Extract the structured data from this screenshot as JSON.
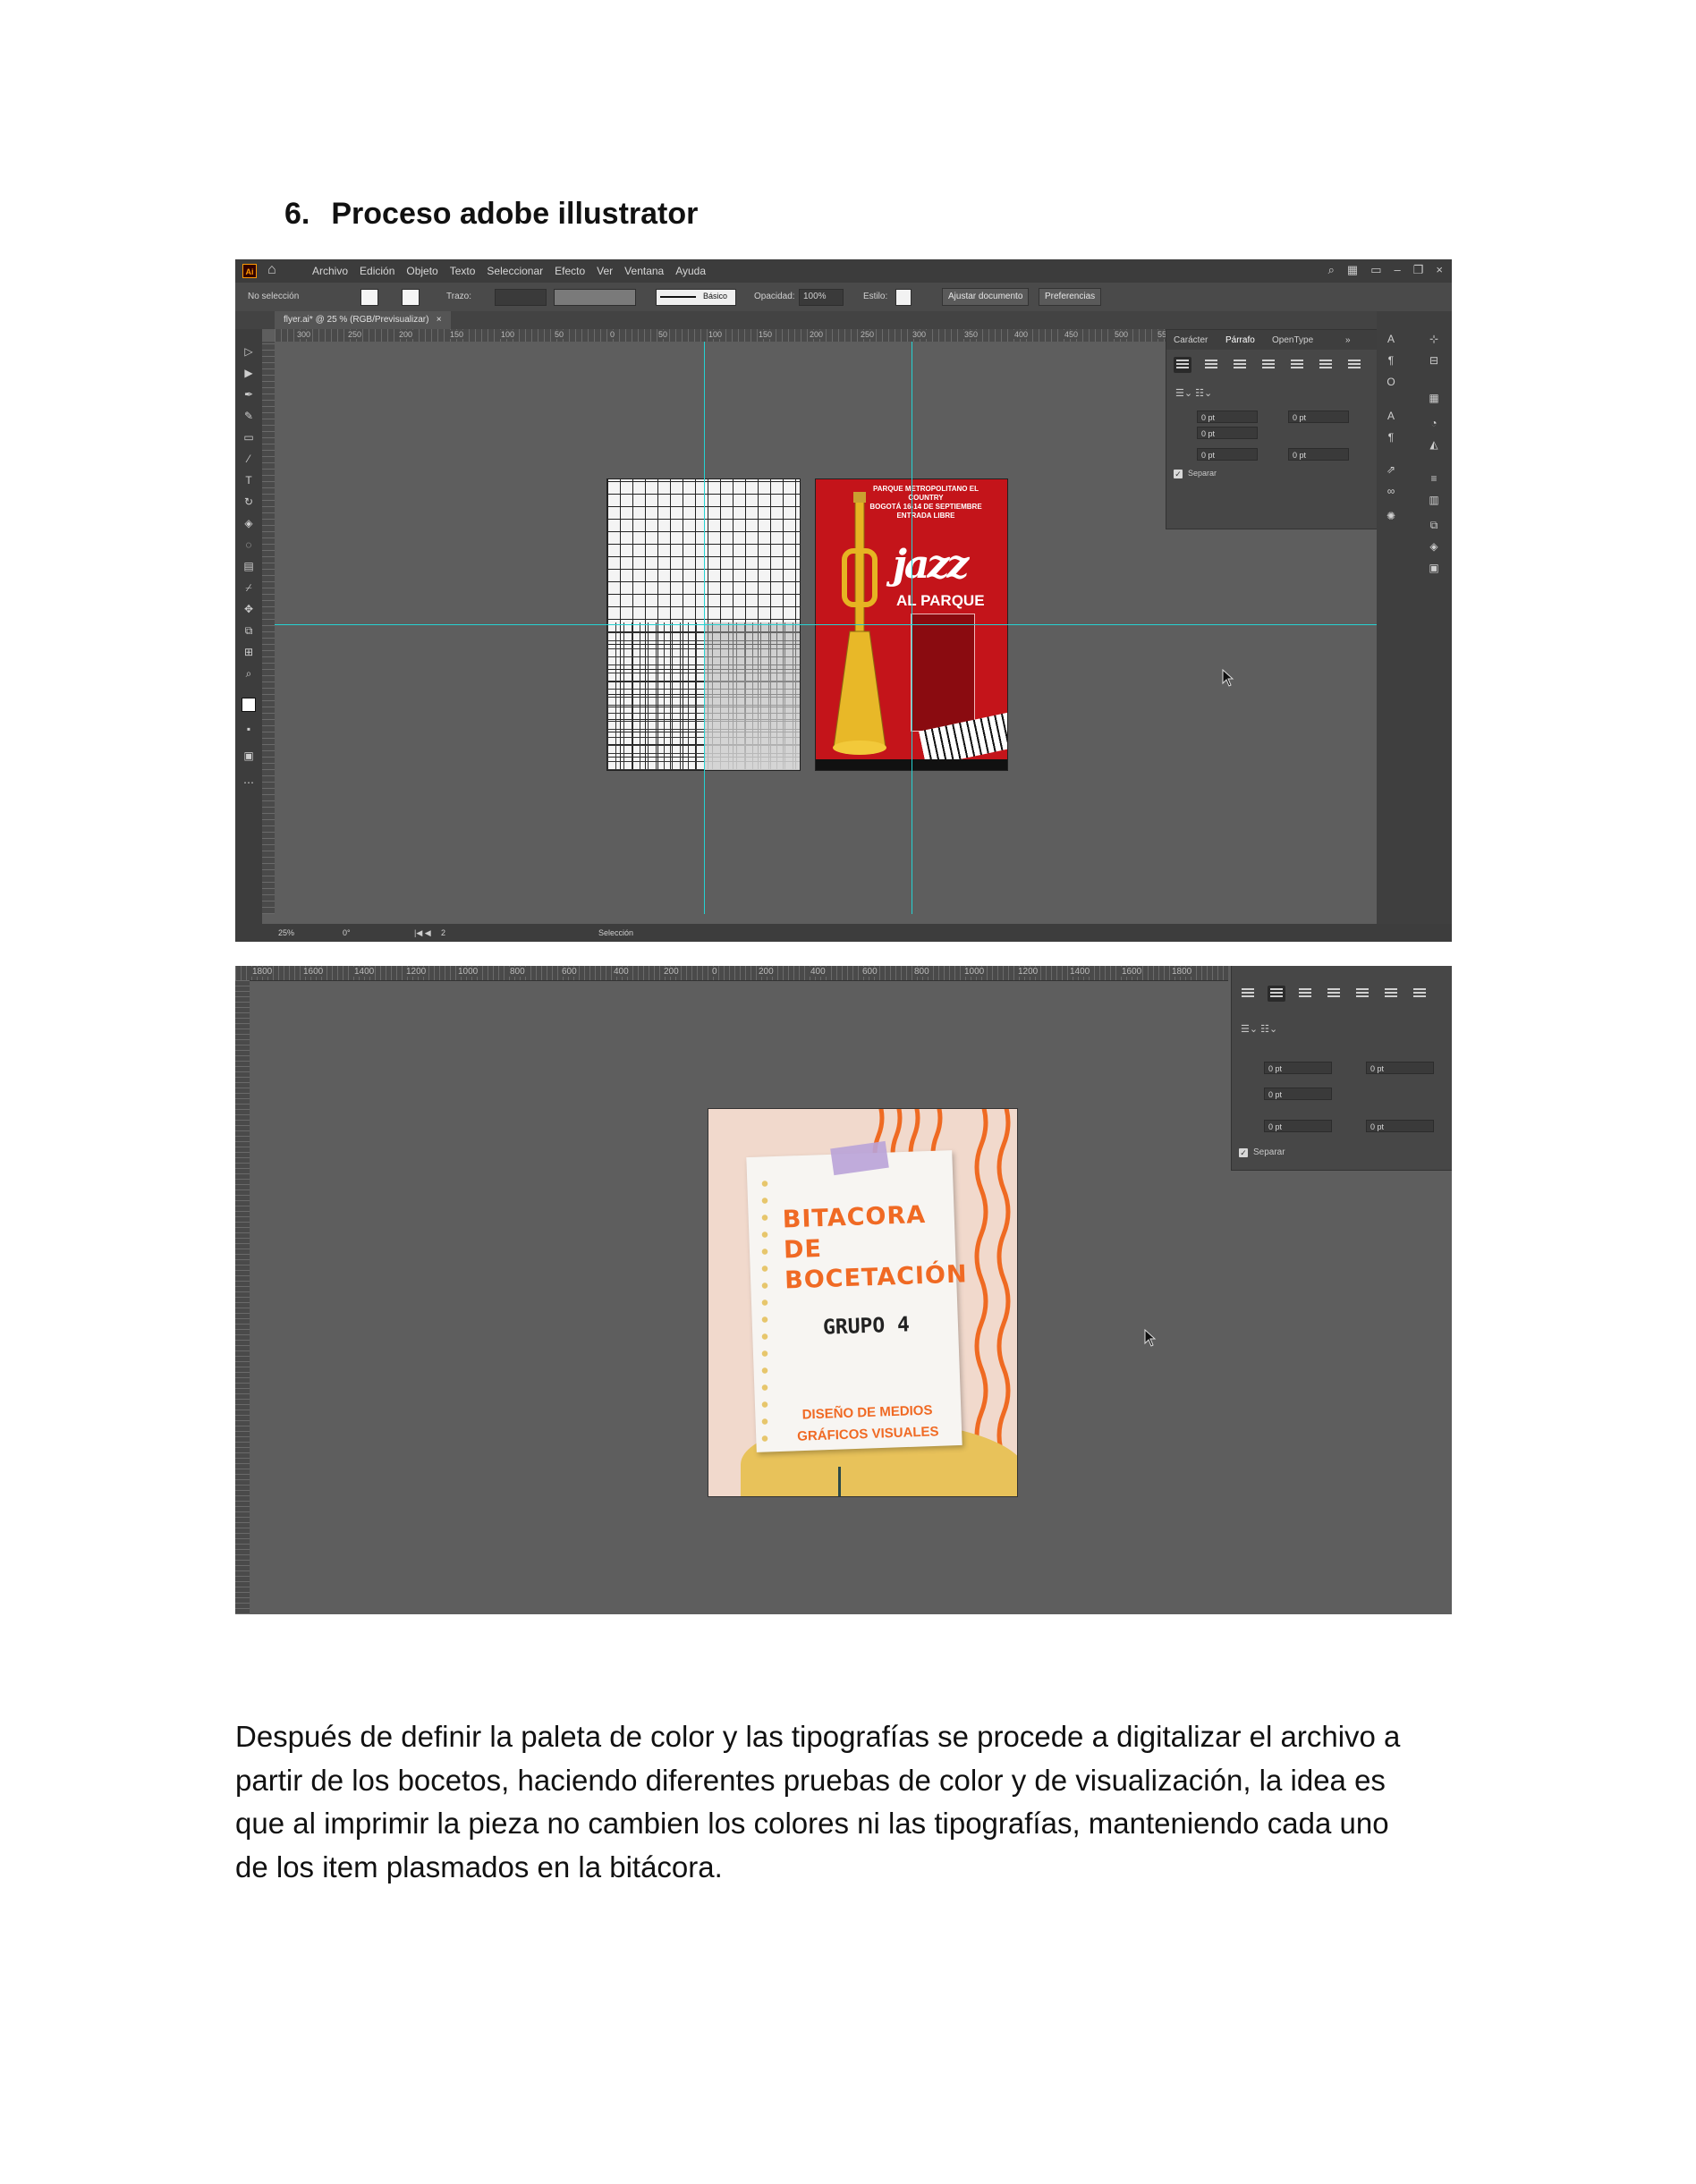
{
  "heading": {
    "number": "6.",
    "title": "Proceso adobe illustrator"
  },
  "screenshot1": {
    "app_logo": "Ai",
    "menu": [
      "Archivo",
      "Edición",
      "Objeto",
      "Texto",
      "Seleccionar",
      "Efecto",
      "Ver",
      "Ventana",
      "Ayuda"
    ],
    "options": {
      "selection": "No selección",
      "stroke_label": "Trazo:",
      "brush": "Básico",
      "opacity_label": "Opacidad:",
      "opacity_value": "100%",
      "style_label": "Estilo:",
      "fit_button": "Ajustar documento",
      "prefs_button": "Preferencias"
    },
    "doc_tab": "flyer.ai* @ 25 % (RGB/Previsualizar)",
    "doc_tab_close": "×",
    "ruler_labels": [
      "300",
      "250",
      "200",
      "150",
      "100",
      "50",
      "0",
      "50",
      "100",
      "150",
      "200",
      "250",
      "300",
      "350",
      "400",
      "450",
      "500",
      "550"
    ],
    "panel": {
      "tabs": [
        "Carácter",
        "Párrafo",
        "OpenType"
      ],
      "fields": [
        "0 pt",
        "0 pt",
        "0 pt",
        "0 pt",
        "0 pt"
      ],
      "checkbox_label": "Separar"
    },
    "poster": {
      "top_text": [
        "PARQUE METROPOLITANO EL",
        "COUNTRY",
        "BOGOTÁ 16-14 DE SEPTIEMBRE",
        "ENTRADA LIBRE"
      ],
      "title": "jazz",
      "subtitle": "AL PARQUE"
    },
    "status": {
      "zoom": "25%",
      "rotation": "0°",
      "artboard": "2",
      "tool": "Selección"
    }
  },
  "screenshot2": {
    "ruler_labels": [
      "1800",
      "1600",
      "1400",
      "1200",
      "1000",
      "800",
      "600",
      "400",
      "200",
      "0",
      "200",
      "400",
      "600",
      "800",
      "1000",
      "1200",
      "1400",
      "1600",
      "1800"
    ],
    "panel": {
      "fields": [
        "0 pt",
        "0 pt",
        "0 pt",
        "0 pt",
        "0 pt"
      ],
      "checkbox_label": "Separar"
    },
    "cover": {
      "title_line1": "BITACORA DE",
      "title_line2": "BOCETACIÓN",
      "group": "GRUPO 4",
      "subtitle_line1": "DISEÑO DE MEDIOS",
      "subtitle_line2": "GRÁFICOS VISUALES"
    }
  },
  "paragraph": [
    "Después de definir la paleta de color y las tipografías se procede a digitalizar el archivo a",
    "partir de los bocetos, haciendo diferentes pruebas de color y de visualización, la idea es",
    "que al imprimir la pieza no cambien los colores ni las tipografías, manteniendo cada uno",
    "de los item plasmados en la bitácora."
  ]
}
